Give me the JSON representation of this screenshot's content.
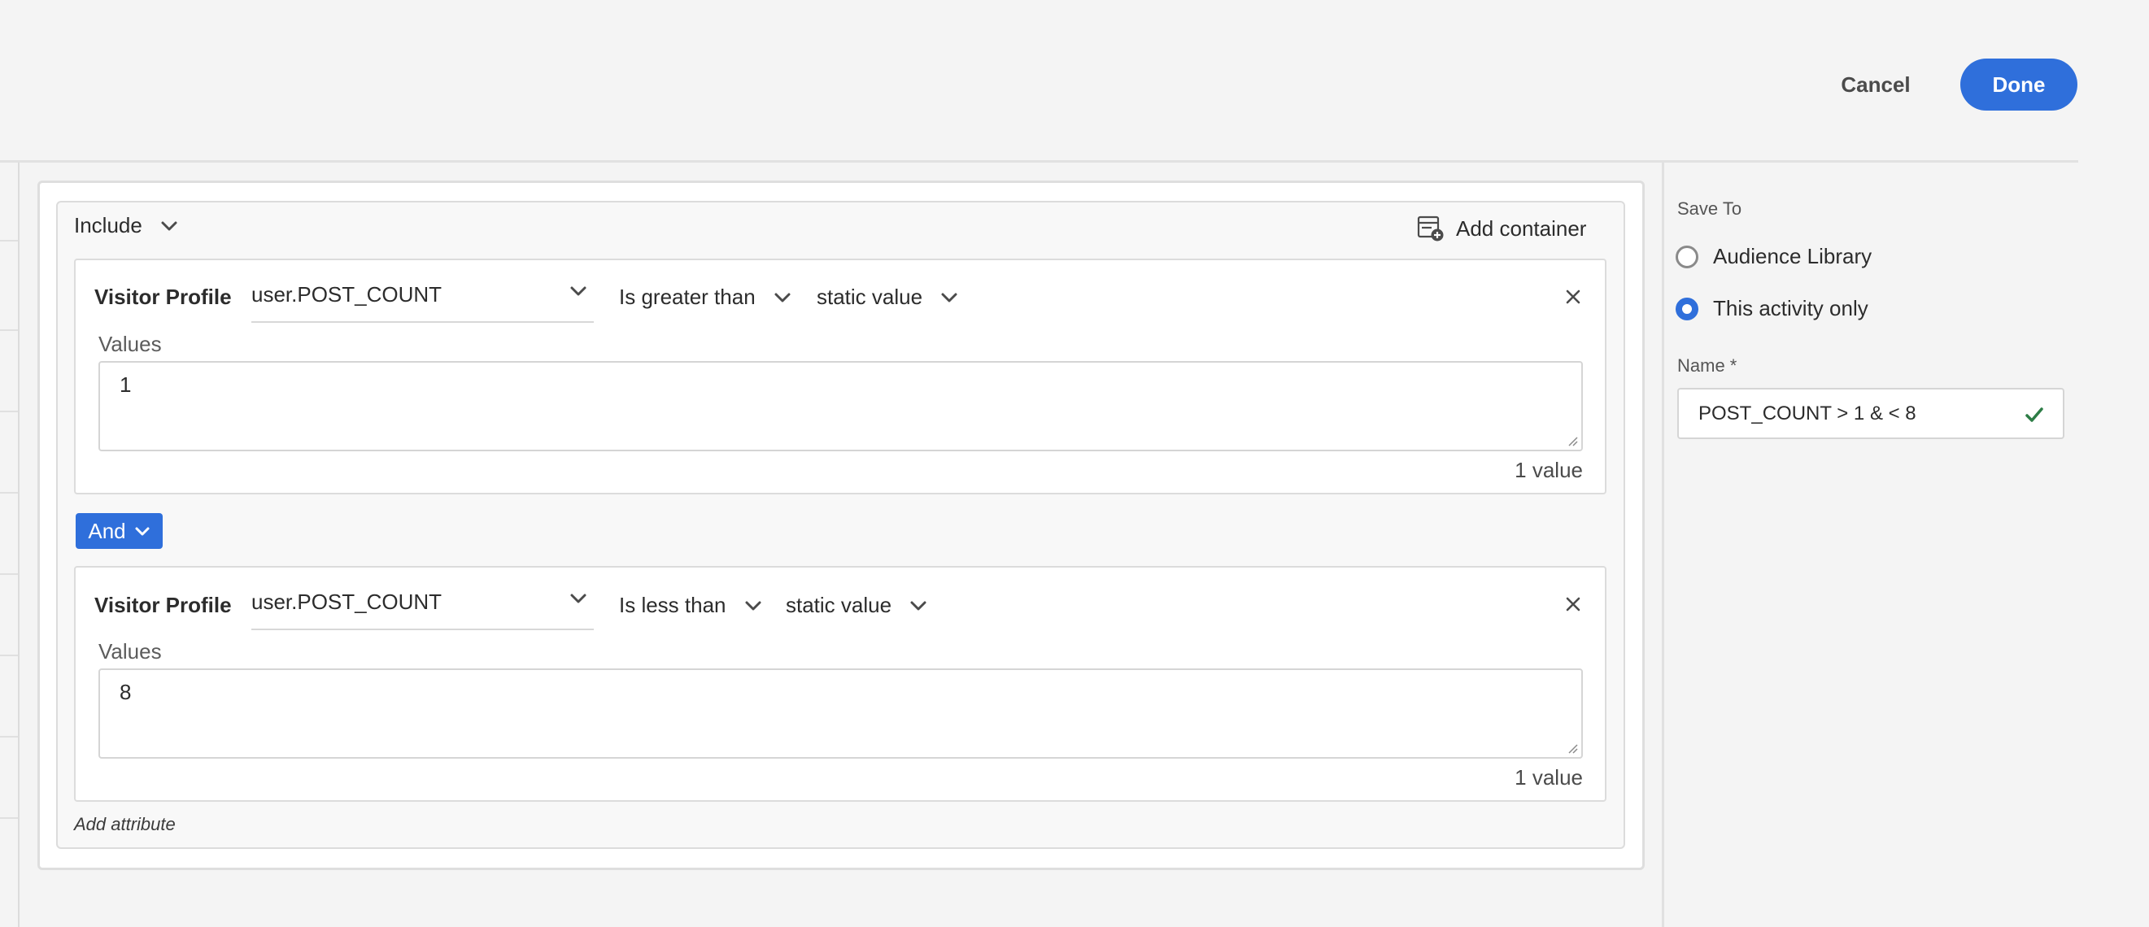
{
  "header": {
    "cancel_label": "Cancel",
    "done_label": "Done"
  },
  "rule_builder": {
    "include_label": "Include",
    "add_container_label": "Add container",
    "conjunction_label": "And",
    "add_attribute_label": "Add attribute",
    "rules": [
      {
        "category": "Visitor Profile",
        "attribute": "user.POST_COUNT",
        "operator": "Is greater than",
        "value_type": "static value",
        "values_label": "Values",
        "value": "1",
        "value_count": "1 value"
      },
      {
        "category": "Visitor Profile",
        "attribute": "user.POST_COUNT",
        "operator": "Is less than",
        "value_type": "static value",
        "values_label": "Values",
        "value": "8",
        "value_count": "1 value"
      }
    ]
  },
  "side_panel": {
    "save_to_label": "Save To",
    "options": [
      {
        "label": "Audience Library",
        "selected": false
      },
      {
        "label": "This activity only",
        "selected": true
      }
    ],
    "name_label": "Name *",
    "name_value": "POST_COUNT > 1 & < 8"
  },
  "colors": {
    "accent": "#2f6fdb",
    "valid_check": "#2d7d46",
    "background": "#f4f4f4"
  },
  "icons": {
    "chevron": "chevron-down-icon",
    "close": "close-icon",
    "add_container": "add-container-icon",
    "check": "checkmark-icon"
  }
}
